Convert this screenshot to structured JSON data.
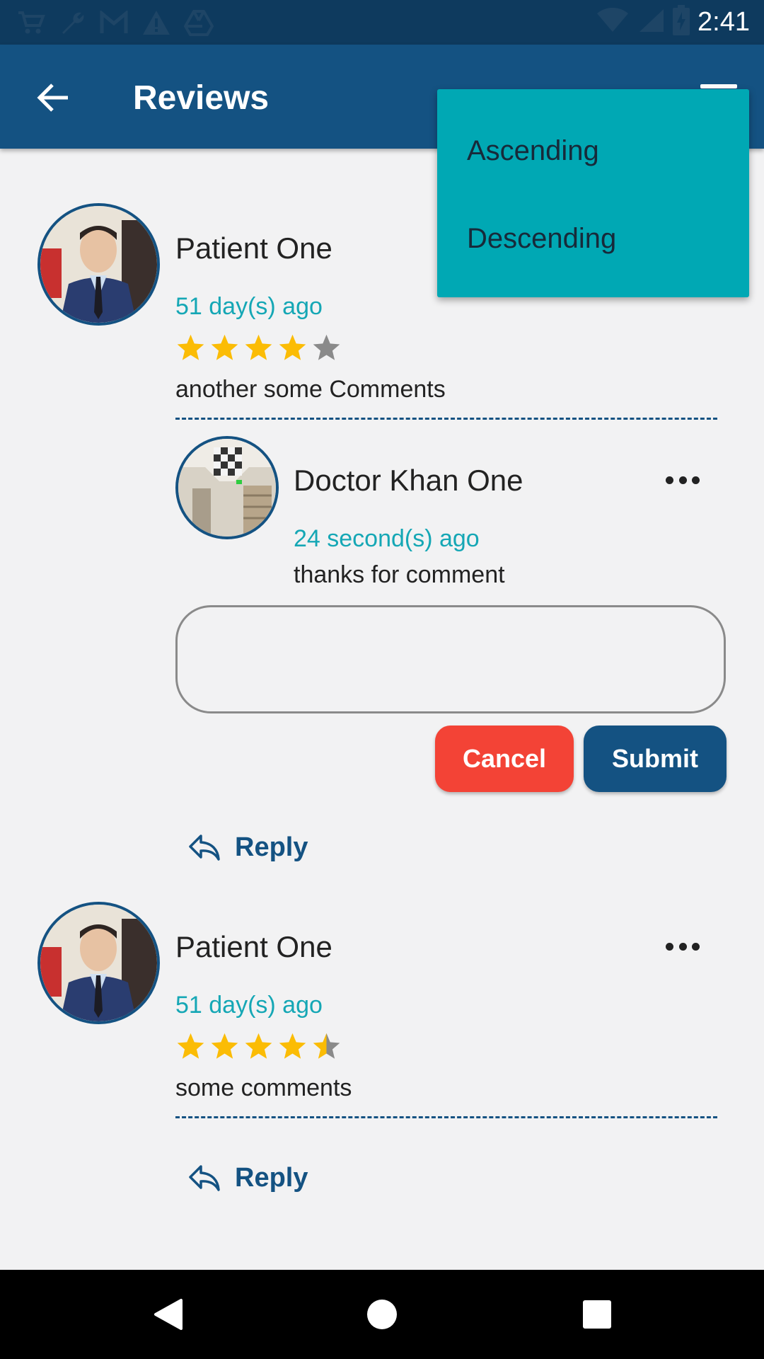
{
  "status_bar": {
    "time": "2:41",
    "left_icons": [
      "cart-icon",
      "wrench-icon",
      "gmail-icon",
      "warning-icon",
      "drive-icon"
    ],
    "right_icons": [
      "wifi-icon",
      "signal-icon",
      "battery-icon"
    ]
  },
  "app_bar": {
    "title": "Reviews",
    "back_icon": "arrow-back-icon",
    "menu_icon": "sort-menu-icon"
  },
  "sort_menu": {
    "options": [
      "Ascending",
      "Descending"
    ]
  },
  "reviews": [
    {
      "author": "Patient One",
      "time": "51 day(s) ago",
      "rating": 4,
      "comment": "another some Comments",
      "reply": {
        "author": "Doctor Khan One",
        "time": "24 second(s) ago",
        "comment": "thanks for comment"
      },
      "reply_input": {
        "value": "",
        "placeholder": ""
      },
      "cancel_label": "Cancel",
      "submit_label": "Submit",
      "reply_label": "Reply"
    },
    {
      "author": "Patient One",
      "time": "51 day(s) ago",
      "rating": 4.5,
      "comment": "some comments",
      "reply_label": "Reply"
    }
  ],
  "colors": {
    "primary": "#145282",
    "accent": "#15a7b5",
    "menu_background": "#00a8b4",
    "star_filled": "#fbbc05",
    "star_empty": "#8a8a8a",
    "cancel": "#f34336"
  }
}
